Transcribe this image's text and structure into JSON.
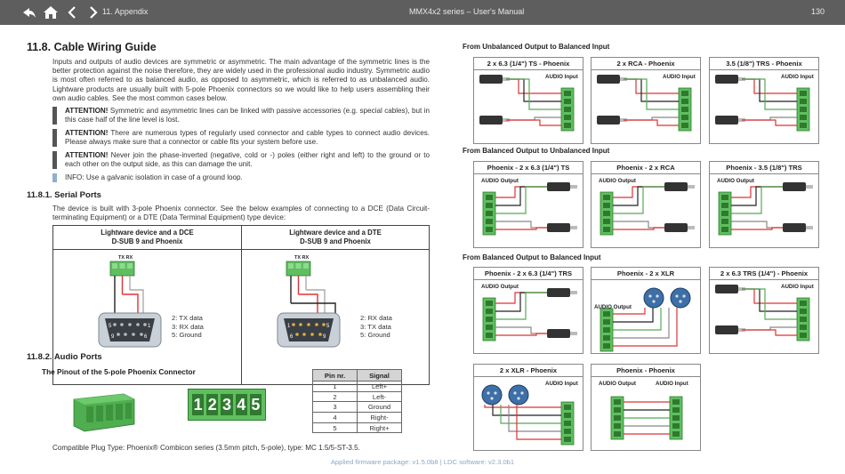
{
  "header": {
    "section": "11. Appendix",
    "manual_title": "MMX4x2 series – User's Manual",
    "page_number": "130",
    "nav_icons": [
      "back-icon",
      "home-icon",
      "prev-page-icon",
      "next-page-icon"
    ]
  },
  "left": {
    "title": "11.8. Cable Wiring Guide",
    "intro": "Inputs and outputs of audio devices are symmetric or asymmetric. The main advantage of the symmetric lines is the better protection against the noise therefore, they are widely used in the professional audio industry. Symmetric audio is most often referred to as balanced audio, as opposed to asymmetric, which is referred to as unbalanced audio. Lightware products are usually built with 5-pole Phoenix connectors so we would like to help users assembling their own audio cables. See the most common cases below.",
    "notices": [
      {
        "label": "ATTENTION!",
        "text": " Symmetric and asymmetric lines can be linked with passive accessories (e.g. special cables), but in this case half of the line level is lost."
      },
      {
        "label": "ATTENTION!",
        "text": " There are numerous types of regularly used connector and cable types to connect audio devices. Please always make sure that a connector or cable fits your system before use."
      },
      {
        "label": "ATTENTION!",
        "text": " Never join the phase-inverted (negative, cold or -) poles (either right and left) to the ground or to each other on the output side, as this can damage the unit."
      }
    ],
    "info": "INFO: Use a galvanic isolation in case of a ground loop.",
    "serial": {
      "heading": "11.8.1. Serial Ports",
      "text": "The device is built with 3-pole Phoenix connector. See the below examples of connecting to a DCE (Data Circuit-terminating Equipment) or a DTE (Data Terminal Equipment) type device:",
      "col1_title_1": "Lightware device and a DCE",
      "col1_title_2": "D-SUB 9 and Phoenix",
      "col2_title_1": "Lightware device and a DTE",
      "col2_title_2": "D-SUB 9 and Phoenix",
      "phoenix_label": "TX RX",
      "col1_legend": [
        "2: TX data",
        "3: RX data",
        "5: Ground"
      ],
      "col2_legend": [
        "2: RX data",
        "3: TX data",
        "5: Ground"
      ],
      "dsub_pins_top": [
        "5",
        "1"
      ],
      "dsub_pins_bottom": [
        "9",
        "6"
      ],
      "dsub2_pins_top": [
        "1",
        "5"
      ],
      "dsub2_pins_bottom": [
        "6",
        "9"
      ]
    },
    "audio": {
      "heading": "11.8.2. Audio Ports",
      "pinout_title": "The Pinout of the 5-pole Phoenix Connector",
      "pin_numbers": [
        "1",
        "2",
        "3",
        "4",
        "5"
      ],
      "table_headers": [
        "Pin nr.",
        "Signal"
      ],
      "table_rows": [
        [
          "1",
          "Left+"
        ],
        [
          "2",
          "Left-"
        ],
        [
          "3",
          "Ground"
        ],
        [
          "4",
          "Right-"
        ],
        [
          "5",
          "Right+"
        ]
      ],
      "plug_type": "Compatible Plug Type: Phoenix® Combicon series (3.5mm pitch, 5-pole), type: MC 1.5/5-ST-3.5."
    }
  },
  "right": {
    "sections": [
      {
        "heading": "From Unbalanced Output to Balanced Input",
        "cards": [
          {
            "title": "2 x 6.3 (1/4\") TS - Phoenix",
            "label": "AUDIO Input"
          },
          {
            "title": "2 x RCA - Phoenix",
            "label": "AUDIO Input"
          },
          {
            "title": "3.5 (1/8\") TRS - Phoenix",
            "label": "AUDIO Input"
          }
        ]
      },
      {
        "heading": "From Balanced Output to Unbalanced Input",
        "cards": [
          {
            "title": "Phoenix - 2 x 6.3 (1/4\") TS",
            "label": "AUDIO Output"
          },
          {
            "title": "Phoenix - 2 x RCA",
            "label": "AUDIO Output"
          },
          {
            "title": "Phoenix - 3.5 (1/8\") TRS",
            "label": "AUDIO Output"
          }
        ]
      },
      {
        "heading": "From Balanced Output to Balanced Input",
        "cards": [
          {
            "title": "Phoenix - 2 x 6.3 (1/4\") TRS",
            "label": "AUDIO Output"
          },
          {
            "title": "Phoenix - 2 x XLR",
            "label": "AUDIO Output"
          },
          {
            "title": "2 x 6.3 TRS (1/4\") - Phoenix",
            "label": "AUDIO Input"
          },
          {
            "title": "2 x XLR - Phoenix",
            "label": "AUDIO Input"
          },
          {
            "title": "Phoenix - Phoenix",
            "label": "AUDIO Output",
            "label2": "AUDIO Input"
          }
        ]
      }
    ]
  },
  "footer": {
    "text": "Applied firmware package: v1.5.0b8    |    LDC software: v2.3.0b1"
  },
  "colors": {
    "header_bg": "#5e5e5e",
    "connector_green": "#5fbf5f",
    "wire_red": "#d33",
    "footer_link": "#8aa8c8"
  }
}
